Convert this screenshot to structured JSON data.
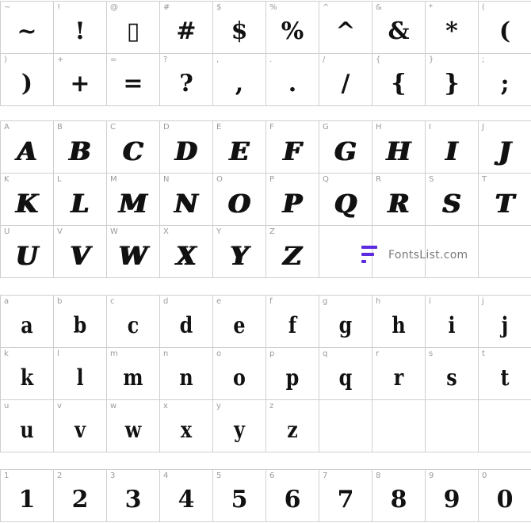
{
  "colors": {
    "grid_line": "#cfcfcf",
    "label": "#9a9a9a",
    "glyph": "#111111",
    "watermark_accent": "#5b2be0",
    "watermark_text": "#7a7a7a"
  },
  "symbols": {
    "cells": [
      {
        "label": "~",
        "glyph": "~"
      },
      {
        "label": "!",
        "glyph": "!"
      },
      {
        "label": "@",
        "glyph": "▯"
      },
      {
        "label": "#",
        "glyph": "#"
      },
      {
        "label": "$",
        "glyph": "$"
      },
      {
        "label": "%",
        "glyph": "%"
      },
      {
        "label": "^",
        "glyph": "^"
      },
      {
        "label": "&",
        "glyph": "&"
      },
      {
        "label": "*",
        "glyph": "*"
      },
      {
        "label": "(",
        "glyph": "("
      },
      {
        "label": ")",
        "glyph": ")"
      },
      {
        "label": "+",
        "glyph": "+"
      },
      {
        "label": "=",
        "glyph": "="
      },
      {
        "label": "?",
        "glyph": "?"
      },
      {
        "label": ",",
        "glyph": ","
      },
      {
        "label": ".",
        "glyph": "."
      },
      {
        "label": "/",
        "glyph": "/"
      },
      {
        "label": "{",
        "glyph": "{"
      },
      {
        "label": "}",
        "glyph": "}"
      },
      {
        "label": ";",
        "glyph": ";"
      }
    ]
  },
  "uppercase": {
    "cells": [
      {
        "label": "A",
        "glyph": "A"
      },
      {
        "label": "B",
        "glyph": "B"
      },
      {
        "label": "C",
        "glyph": "C"
      },
      {
        "label": "D",
        "glyph": "D"
      },
      {
        "label": "E",
        "glyph": "E"
      },
      {
        "label": "F",
        "glyph": "F"
      },
      {
        "label": "G",
        "glyph": "G"
      },
      {
        "label": "H",
        "glyph": "H"
      },
      {
        "label": "I",
        "glyph": "I"
      },
      {
        "label": "J",
        "glyph": "J"
      },
      {
        "label": "K",
        "glyph": "K"
      },
      {
        "label": "L",
        "glyph": "L"
      },
      {
        "label": "M",
        "glyph": "M"
      },
      {
        "label": "N",
        "glyph": "N"
      },
      {
        "label": "O",
        "glyph": "O"
      },
      {
        "label": "P",
        "glyph": "P"
      },
      {
        "label": "Q",
        "glyph": "Q"
      },
      {
        "label": "R",
        "glyph": "R"
      },
      {
        "label": "S",
        "glyph": "S"
      },
      {
        "label": "T",
        "glyph": "T"
      },
      {
        "label": "U",
        "glyph": "U"
      },
      {
        "label": "V",
        "glyph": "V"
      },
      {
        "label": "W",
        "glyph": "W"
      },
      {
        "label": "X",
        "glyph": "X"
      },
      {
        "label": "Y",
        "glyph": "Y"
      },
      {
        "label": "Z",
        "glyph": "Z"
      }
    ]
  },
  "lowercase": {
    "cells": [
      {
        "label": "a",
        "glyph": "a"
      },
      {
        "label": "b",
        "glyph": "b"
      },
      {
        "label": "c",
        "glyph": "c"
      },
      {
        "label": "d",
        "glyph": "d"
      },
      {
        "label": "e",
        "glyph": "e"
      },
      {
        "label": "f",
        "glyph": "f"
      },
      {
        "label": "g",
        "glyph": "g"
      },
      {
        "label": "h",
        "glyph": "h"
      },
      {
        "label": "i",
        "glyph": "i"
      },
      {
        "label": "j",
        "glyph": "j"
      },
      {
        "label": "k",
        "glyph": "k"
      },
      {
        "label": "l",
        "glyph": "l"
      },
      {
        "label": "m",
        "glyph": "m"
      },
      {
        "label": "n",
        "glyph": "n"
      },
      {
        "label": "o",
        "glyph": "o"
      },
      {
        "label": "p",
        "glyph": "p"
      },
      {
        "label": "q",
        "glyph": "q"
      },
      {
        "label": "r",
        "glyph": "r"
      },
      {
        "label": "s",
        "glyph": "s"
      },
      {
        "label": "t",
        "glyph": "t"
      },
      {
        "label": "u",
        "glyph": "u"
      },
      {
        "label": "v",
        "glyph": "v"
      },
      {
        "label": "w",
        "glyph": "w"
      },
      {
        "label": "x",
        "glyph": "x"
      },
      {
        "label": "y",
        "glyph": "y"
      },
      {
        "label": "z",
        "glyph": "z"
      }
    ]
  },
  "digits": {
    "cells": [
      {
        "label": "1",
        "glyph": "1"
      },
      {
        "label": "2",
        "glyph": "2"
      },
      {
        "label": "3",
        "glyph": "3"
      },
      {
        "label": "4",
        "glyph": "4"
      },
      {
        "label": "5",
        "glyph": "5"
      },
      {
        "label": "6",
        "glyph": "6"
      },
      {
        "label": "7",
        "glyph": "7"
      },
      {
        "label": "8",
        "glyph": "8"
      },
      {
        "label": "9",
        "glyph": "9"
      },
      {
        "label": "0",
        "glyph": "0"
      }
    ]
  },
  "watermark": {
    "icon": "fontslist-logo-icon",
    "text": "FontsList.com"
  }
}
